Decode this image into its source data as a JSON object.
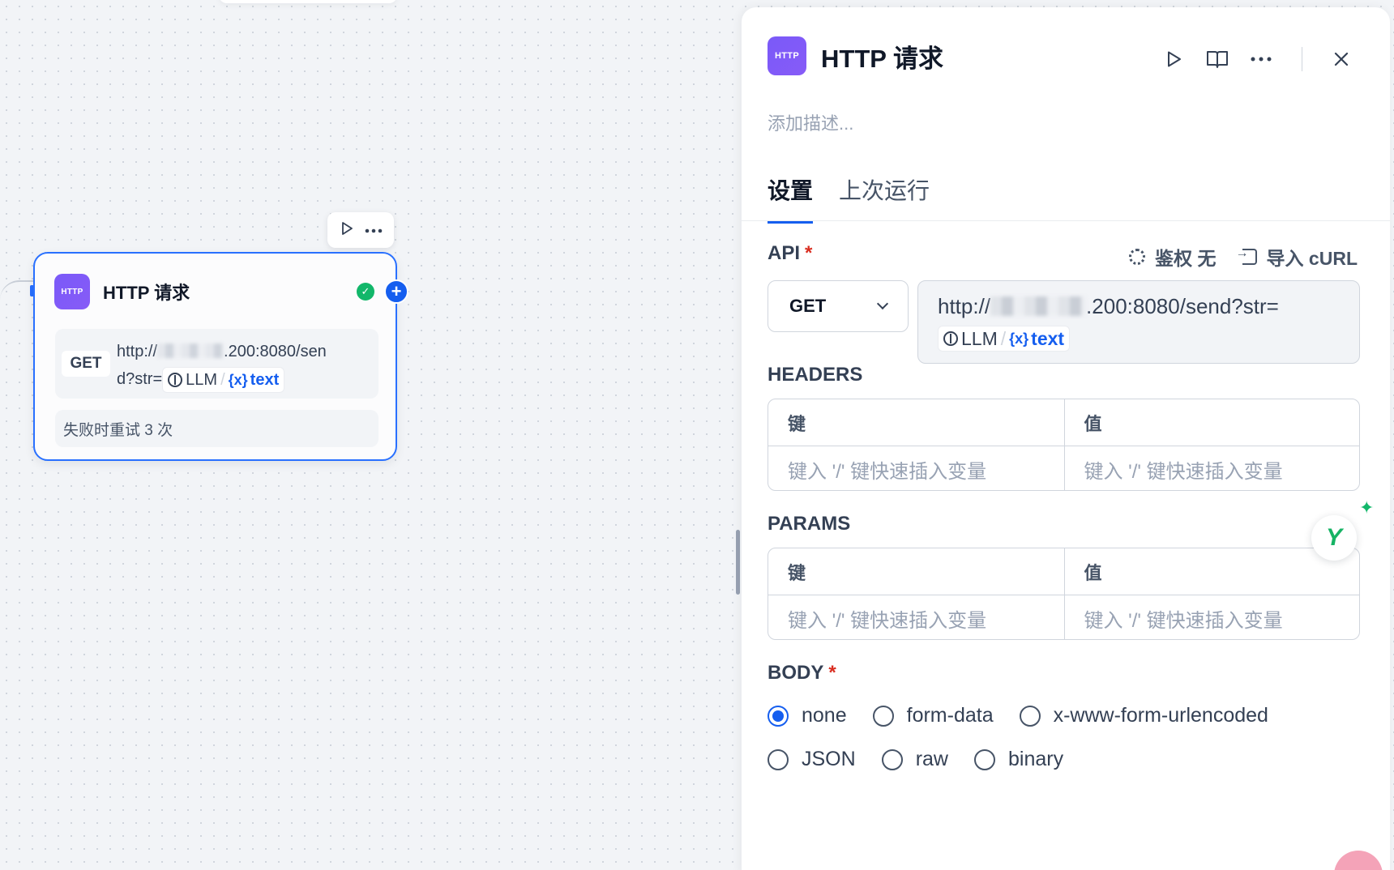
{
  "node": {
    "title": "HTTP 请求",
    "icon_text": "HTTP",
    "method": "GET",
    "url_prefix": "http://",
    "url_suffix": ".200:8080/sen",
    "url_line2": "d?str=",
    "var_source": "LLM",
    "var_separator": "/",
    "var_name": "text",
    "var_icon": "{x}",
    "retry": "失败时重试 3 次"
  },
  "panel": {
    "title": "HTTP 请求",
    "icon_text": "HTTP",
    "description_placeholder": "添加描述...",
    "tabs": [
      {
        "label": "设置",
        "active": true
      },
      {
        "label": "上次运行",
        "active": false
      }
    ],
    "api": {
      "label": "API",
      "required_mark": "*",
      "auth_label": "鉴权 无",
      "import_label": "导入 cURL",
      "method": "GET",
      "url_prefix": "http://",
      "url_suffix": ".200:8080/send?str=",
      "var_source": "LLM",
      "var_separator": "/",
      "var_icon": "{x}",
      "var_name": "text"
    },
    "headers": {
      "label": "HEADERS",
      "key_header": "键",
      "value_header": "值",
      "key_placeholder": "键入 '/' 键快速插入变量",
      "value_placeholder": "键入 '/' 键快速插入变量"
    },
    "params": {
      "label": "PARAMS",
      "key_header": "键",
      "value_header": "值",
      "key_placeholder": "键入 '/' 键快速插入变量",
      "value_placeholder": "键入 '/' 键快速插入变量"
    },
    "body": {
      "label": "BODY",
      "required_mark": "*",
      "options_row1": [
        "none",
        "form-data",
        "x-www-form-urlencoded"
      ],
      "options_row2": [
        "JSON",
        "raw",
        "binary"
      ],
      "selected": "none"
    }
  },
  "icons": {
    "run": "play-icon",
    "docs": "book-icon",
    "more": "more-icon",
    "close": "close-icon",
    "status": "check-circle-icon",
    "add": "plus-icon"
  },
  "colors": {
    "accent": "#155eef",
    "node_icon": "#7a5af8",
    "required": "#d92d20",
    "success": "#12b76a"
  }
}
